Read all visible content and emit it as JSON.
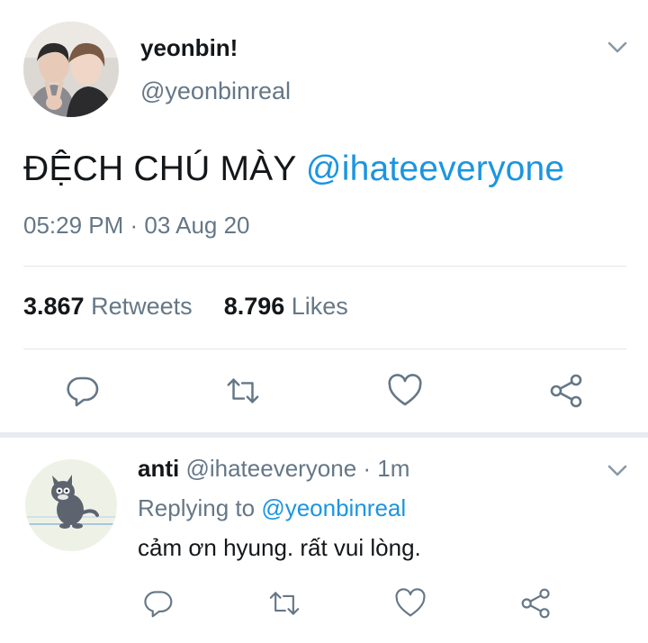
{
  "tweet": {
    "display_name": "yeonbin!",
    "handle": "@yeonbinreal",
    "text_main": "ĐỆCH CHÚ MÀY ",
    "text_mention": "@ihateeveryone",
    "timestamp": "05:29 PM · 03 Aug 20",
    "retweets_count": "3.867",
    "retweets_label": "Retweets",
    "likes_count": "8.796",
    "likes_label": "Likes",
    "actions": {
      "reply_icon": "comment-icon",
      "retweet_icon": "retweet-icon",
      "like_icon": "heart-icon",
      "share_icon": "share-icon"
    }
  },
  "reply": {
    "display_name": "anti",
    "meta": " @ihateeveryone · 1m",
    "replying_prefix": "Replying to ",
    "replying_to": "@yeonbinreal",
    "text": "cảm ơn hyung. rất vui lòng."
  },
  "colors": {
    "accent": "#1b95e0",
    "secondary_text": "#657786",
    "divider": "#e1e8ed"
  }
}
